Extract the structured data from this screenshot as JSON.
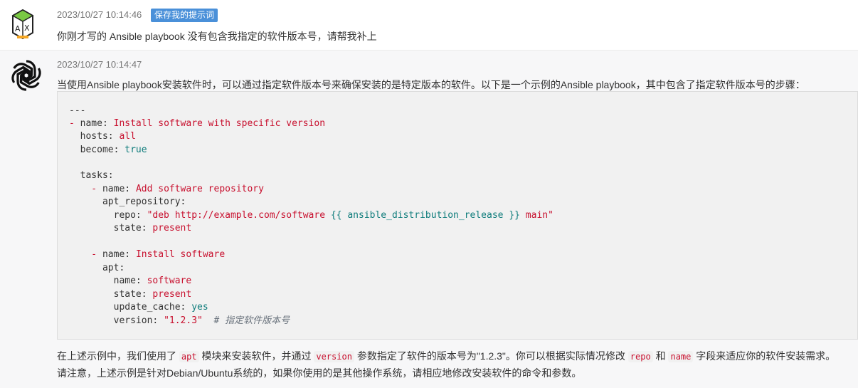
{
  "user_message": {
    "timestamp": "2023/10/27 10:14:46",
    "save_prompt_label": "保存我的提示词",
    "text": "你刚才写的 Ansible playbook 没有包含我指定的软件版本号，请帮我补上"
  },
  "assistant_message": {
    "timestamp": "2023/10/27 10:14:47",
    "intro": "当使用Ansible playbook安装软件时，可以通过指定软件版本号来确保安装的是特定版本的软件。以下是一个示例的Ansible playbook，其中包含了指定软件版本号的步骤：",
    "code": {
      "l1": "---",
      "l2_dash": "- ",
      "l2_key": "name: ",
      "l2_val": "Install software with specific version",
      "l3_key": "  hosts: ",
      "l3_val": "all",
      "l4_key": "  become: ",
      "l4_val": "true",
      "l6_key": "  tasks:",
      "l7_dash": "    - ",
      "l7_key": "name: ",
      "l7_val": "Add software repository",
      "l8_key": "      apt_repository:",
      "l9_key": "        repo: ",
      "l9_val1": "\"deb http://example.com/software ",
      "l9_tpl": "{{ ansible_distribution_release }}",
      "l9_val2": " main\"",
      "l10_key": "        state: ",
      "l10_val": "present",
      "l12_dash": "    - ",
      "l12_key": "name: ",
      "l12_val": "Install software",
      "l13_key": "      apt:",
      "l14_key": "        name: ",
      "l14_val": "software",
      "l15_key": "        state: ",
      "l15_val": "present",
      "l16_key": "        update_cache: ",
      "l16_val": "yes",
      "l17_key": "        version: ",
      "l17_val": "\"1.2.3\"",
      "l17_comment": "  # 指定软件版本号"
    },
    "outro1_a": "在上述示例中，我们使用了",
    "outro1_code1": "apt",
    "outro1_b": "模块来安装软件，并通过",
    "outro1_code2": "version",
    "outro1_c": "参数指定了软件的版本号为\"1.2.3\"。你可以根据实际情况修改",
    "outro1_code3": "repo",
    "outro1_d": "和",
    "outro1_code4": "name",
    "outro1_e": "字段来适应你的软件安装需求。",
    "outro2": "请注意，上述示例是针对Debian/Ubuntu系统的，如果你使用的是其他操作系统，请相应地修改安装软件的命令和参数。"
  }
}
